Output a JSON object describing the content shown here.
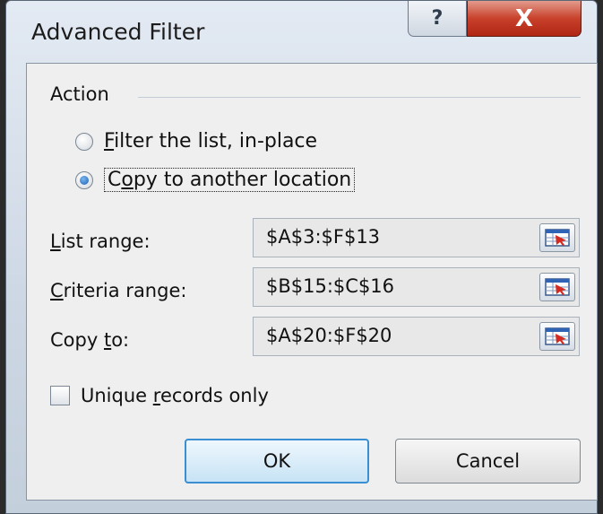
{
  "dialog": {
    "title": "Advanced Filter",
    "help_glyph": "?",
    "close_glyph": "X"
  },
  "action": {
    "group_label": "Action",
    "options": [
      {
        "mnemonic": "F",
        "rest": "ilter the list, in-place",
        "selected": false
      },
      {
        "pre": "C",
        "mnemonic": "o",
        "rest": "py to another location",
        "selected": true
      }
    ]
  },
  "ranges": [
    {
      "pre": "",
      "mnemonic": "L",
      "rest": "ist range:",
      "value": "$A$3:$F$13"
    },
    {
      "pre": "",
      "mnemonic": "C",
      "rest": "riteria range:",
      "value": "$B$15:$C$16"
    },
    {
      "pre": "Copy ",
      "mnemonic": "t",
      "rest": "o:",
      "value": "$A$20:$F$20"
    }
  ],
  "unique": {
    "pre": "Unique ",
    "mnemonic": "r",
    "rest": "ecords only",
    "checked": false
  },
  "buttons": {
    "ok": "OK",
    "cancel": "Cancel"
  },
  "icons": {
    "range_picker": "collapse-dialog-icon",
    "help": "help-icon",
    "close": "close-icon"
  }
}
